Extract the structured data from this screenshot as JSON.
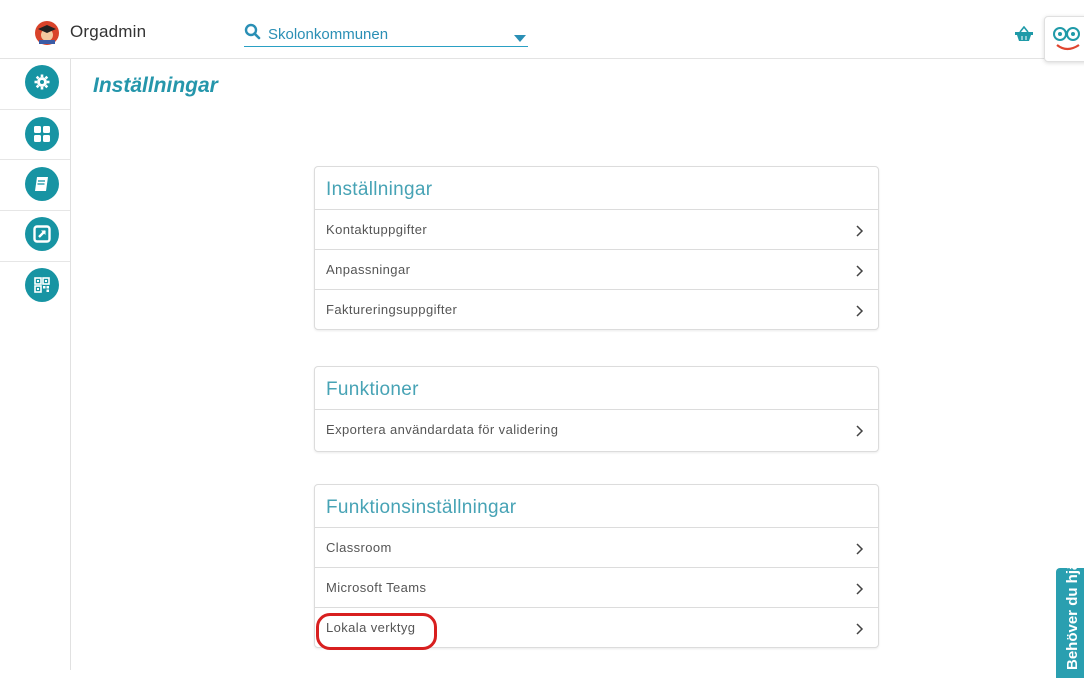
{
  "app": {
    "title": "Orgadmin"
  },
  "org_selector": {
    "value": "Skolonkommunen"
  },
  "page": {
    "title": "Inställningar"
  },
  "sections": [
    {
      "title": "Inställningar",
      "items": [
        "Kontaktuppgifter",
        "Anpassningar",
        "Faktureringsuppgifter"
      ]
    },
    {
      "title": "Funktioner",
      "items": [
        "Exportera användardata för validering"
      ]
    },
    {
      "title": "Funktionsinställningar",
      "items": [
        "Classroom",
        "Microsoft Teams",
        "Lokala verktyg"
      ]
    }
  ],
  "help_tab": {
    "label": "Behöver du hjälp?"
  },
  "sidebar": {
    "icons": [
      "settings-icon",
      "dashboard-icon",
      "book-icon",
      "external-link-icon",
      "qr-code-icon"
    ]
  },
  "colors": {
    "accent": "#1794a3",
    "heading": "#2596ab",
    "highlight": "#d81f1f"
  }
}
